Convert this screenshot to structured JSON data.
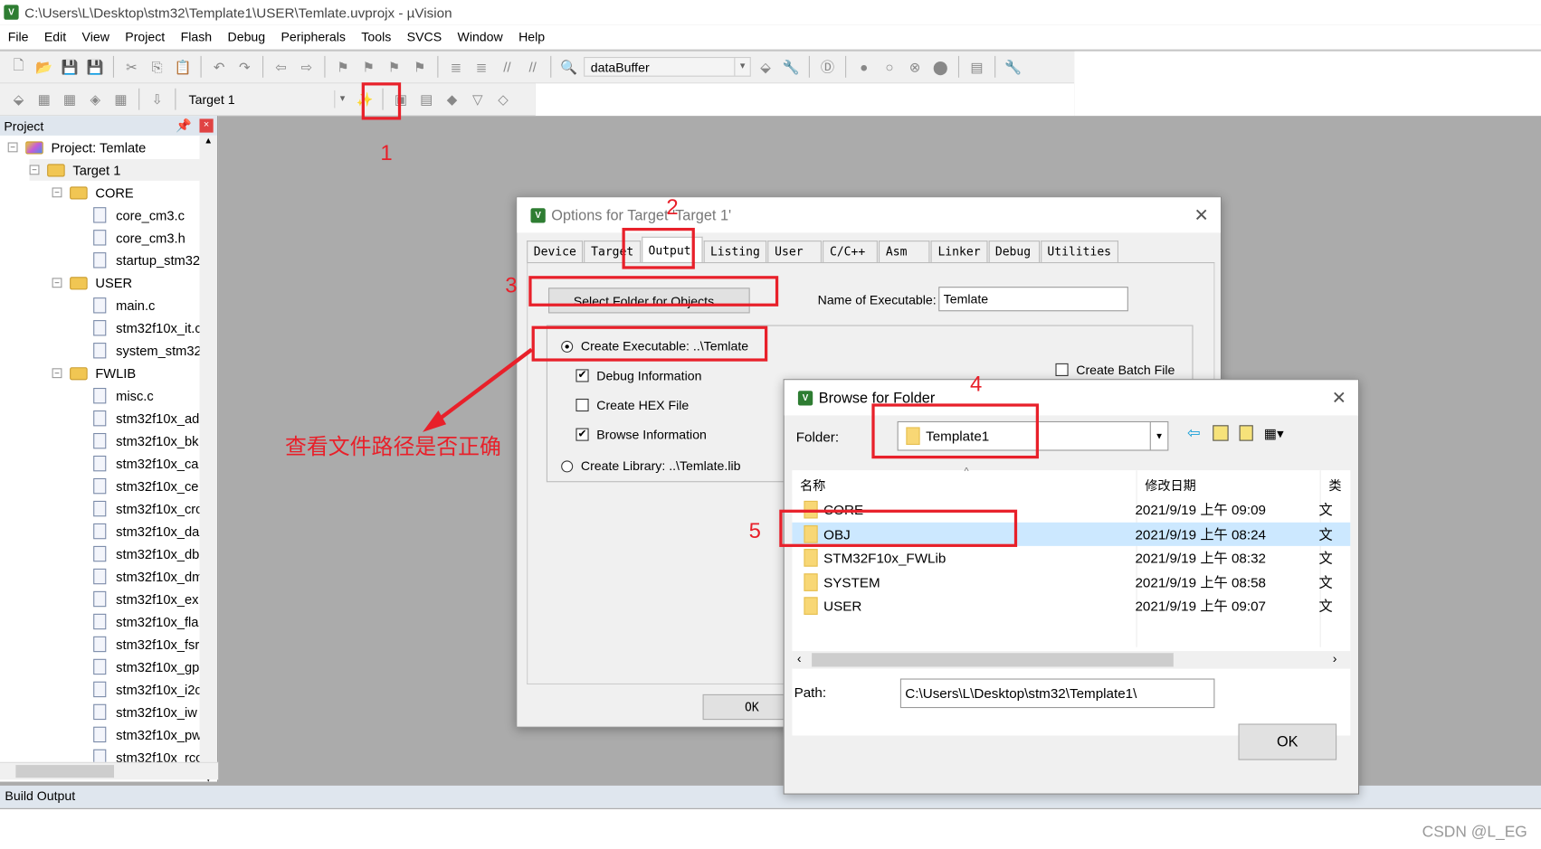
{
  "window": {
    "title": "C:\\Users\\L\\Desktop\\stm32\\Template1\\USER\\Temlate.uvprojx - µVision"
  },
  "menu": [
    "File",
    "Edit",
    "View",
    "Project",
    "Flash",
    "Debug",
    "Peripherals",
    "Tools",
    "SVCS",
    "Window",
    "Help"
  ],
  "toolbar": {
    "find_combo": "dataBuffer",
    "target_combo": "Target 1"
  },
  "project_panel": {
    "title": "Project",
    "root": "Project: Temlate",
    "target": "Target 1",
    "groups": [
      {
        "name": "CORE",
        "files": [
          "core_cm3.c",
          "core_cm3.h",
          "startup_stm32"
        ]
      },
      {
        "name": "USER",
        "files": [
          "main.c",
          "stm32f10x_it.c",
          "system_stm32"
        ]
      },
      {
        "name": "FWLIB",
        "files": [
          "misc.c",
          "stm32f10x_ad",
          "stm32f10x_bk",
          "stm32f10x_ca",
          "stm32f10x_ce",
          "stm32f10x_crc",
          "stm32f10x_da",
          "stm32f10x_db",
          "stm32f10x_dm",
          "stm32f10x_ex",
          "stm32f10x_fla",
          "stm32f10x_fsr",
          "stm32f10x_gp",
          "stm32f10x_i2c",
          "stm32f10x_iw",
          "stm32f10x_pw",
          "stm32f10x_rcc"
        ]
      }
    ]
  },
  "build_output": {
    "title": "Build Output"
  },
  "options_dialog": {
    "title": "Options for Target 'Target 1'",
    "tabs": [
      "Device",
      "Target",
      "Output",
      "Listing",
      "User",
      "C/C++",
      "Asm",
      "Linker",
      "Debug",
      "Utilities"
    ],
    "active_tab": "Output",
    "select_folder_button": "Select Folder for Objects...",
    "name_label": "Name of Executable:",
    "name_value": "Temlate",
    "create_executable": "Create Executable:  ..\\Temlate",
    "debug_info": "Debug Information",
    "debug_info_checked": true,
    "create_hex": "Create HEX File",
    "create_hex_checked": false,
    "browse_info": "Browse Information",
    "browse_info_checked": true,
    "create_library": "Create Library:  ..\\Temlate.lib",
    "create_batch": "Create Batch File",
    "ok": "OK"
  },
  "browse_dialog": {
    "title": "Browse for Folder",
    "folder_label": "Folder:",
    "folder_value": "Template1",
    "columns": [
      "名称",
      "修改日期",
      "类"
    ],
    "rows": [
      {
        "name": "CORE",
        "date": "2021/9/19 上午 09:09",
        "type": "文"
      },
      {
        "name": "OBJ",
        "date": "2021/9/19 上午 08:24",
        "type": "文",
        "selected": true
      },
      {
        "name": "STM32F10x_FWLib",
        "date": "2021/9/19 上午 08:32",
        "type": "文"
      },
      {
        "name": "SYSTEM",
        "date": "2021/9/19 上午 08:58",
        "type": "文"
      },
      {
        "name": "USER",
        "date": "2021/9/19 上午 09:07",
        "type": "文"
      }
    ],
    "path_label": "Path:",
    "path_value": "C:\\Users\\L\\Desktop\\stm32\\Template1\\",
    "ok": "OK"
  },
  "annotations": {
    "steps": [
      "1",
      "2",
      "3",
      "4",
      "5"
    ],
    "note": "查看文件路径是否正确",
    "color": "#e8202a"
  },
  "watermark": "CSDN @L_EG"
}
